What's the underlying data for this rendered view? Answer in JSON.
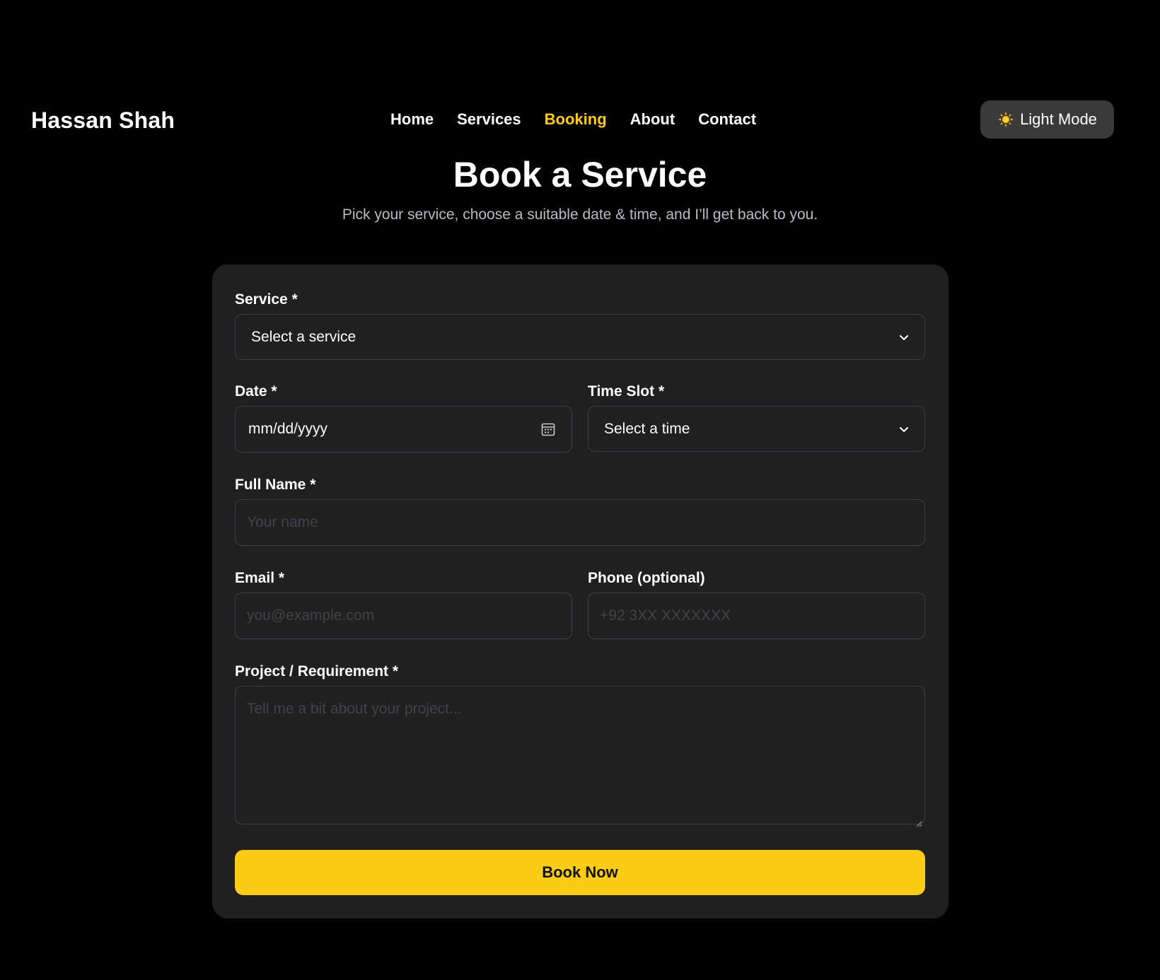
{
  "header": {
    "brand": "Hassan Shah",
    "nav": [
      {
        "label": "Home",
        "active": false
      },
      {
        "label": "Services",
        "active": false
      },
      {
        "label": "Booking",
        "active": true
      },
      {
        "label": "About",
        "active": false
      },
      {
        "label": "Contact",
        "active": false
      }
    ],
    "theme_toggle": {
      "icon": "sun-icon",
      "label": "Light Mode"
    }
  },
  "hero": {
    "title": "Book a Service",
    "subtitle": "Pick your service, choose a suitable date & time, and I’ll get back to you."
  },
  "form": {
    "service": {
      "label": "Service *",
      "value": "Select a service"
    },
    "date": {
      "label": "Date *",
      "value": "mm/dd/yyyy"
    },
    "time_slot": {
      "label": "Time Slot *",
      "value": "Select a time"
    },
    "full_name": {
      "label": "Full Name *",
      "placeholder": "Your name",
      "value": ""
    },
    "email": {
      "label": "Email *",
      "placeholder": "you@example.com",
      "value": ""
    },
    "phone": {
      "label": "Phone (optional)",
      "placeholder": "+92 3XX XXXXXXX",
      "value": ""
    },
    "project": {
      "label": "Project / Requirement *",
      "placeholder": "Tell me a bit about your project...",
      "value": ""
    },
    "submit_label": "Book Now"
  },
  "colors": {
    "background": "#000000",
    "card": "#202020",
    "accent": "#facc15",
    "input_border": "#3b3f48",
    "subtitle": "#b8bcc6",
    "placeholder": "#3f434b"
  }
}
